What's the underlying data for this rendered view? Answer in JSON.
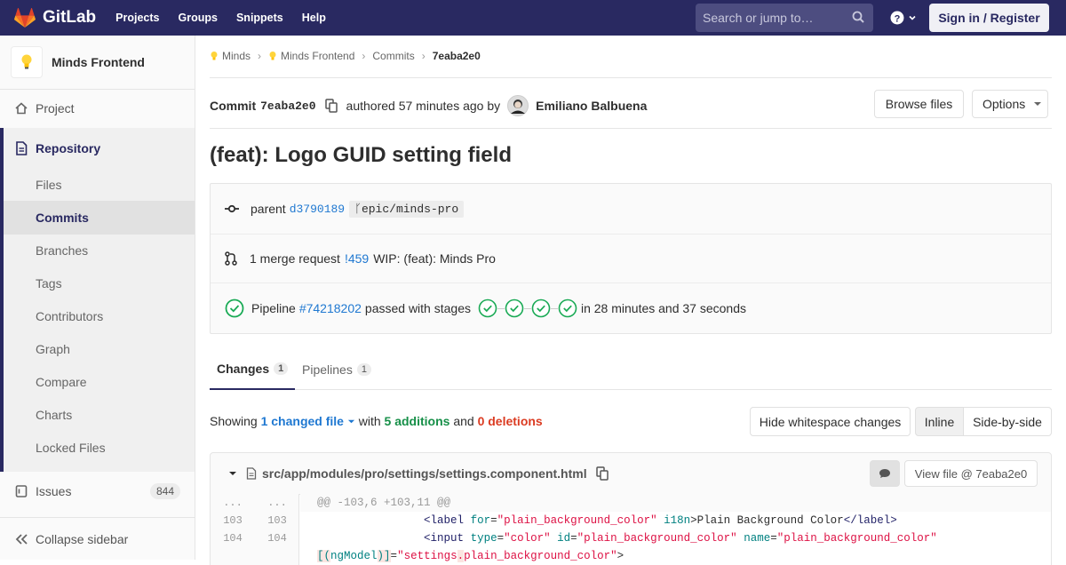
{
  "topbar": {
    "brand": "GitLab",
    "nav": [
      "Projects",
      "Groups",
      "Snippets",
      "Help"
    ],
    "search_placeholder": "Search or jump to…",
    "sign_in": "Sign in / Register"
  },
  "sidebar": {
    "project_name": "Minds Frontend",
    "project": "Project",
    "repository": "Repository",
    "repo_items": [
      "Files",
      "Commits",
      "Branches",
      "Tags",
      "Contributors",
      "Graph",
      "Compare",
      "Charts",
      "Locked Files"
    ],
    "issues": "Issues",
    "issues_count": "844",
    "collapse": "Collapse sidebar"
  },
  "breadcrumbs": [
    "Minds",
    "Minds Frontend",
    "Commits",
    "7eaba2e0"
  ],
  "commit": {
    "label": "Commit",
    "sha": "7eaba2e0",
    "authored": "authored 57 minutes ago by",
    "author": "Emiliano Balbuena",
    "browse_files": "Browse files",
    "options": "Options",
    "title": "(feat): Logo GUID setting field"
  },
  "info": {
    "parent_label": "parent",
    "parent_sha": "d3790189",
    "branch": "epic/minds-pro",
    "mr_text": "1 merge request",
    "mr_link": "!459",
    "mr_title": "WIP: (feat): Minds Pro",
    "pipeline_label": "Pipeline",
    "pipeline_link": "#74218202",
    "pipeline_passed": "passed with stages",
    "pipeline_time": "in 28 minutes and 37 seconds",
    "stage_count": 4
  },
  "tabs": [
    {
      "label": "Changes",
      "count": "1"
    },
    {
      "label": "Pipelines",
      "count": "1"
    }
  ],
  "summary": {
    "showing": "Showing",
    "changed": "1 changed file",
    "with": "with",
    "additions": "5 additions",
    "and": "and",
    "deletions": "0 deletions",
    "hide_ws": "Hide whitespace changes",
    "inline": "Inline",
    "side": "Side-by-side"
  },
  "file": {
    "path": "src/app/modules/pro/settings/settings.component.html",
    "view_file": "View file @ 7eaba2e0"
  },
  "diff": {
    "hunk_old": "...",
    "hunk_new": "...",
    "hunk_header": "@@ -103,6 +103,11 @@",
    "l1_old": "103",
    "l1_new": "103",
    "l2_old": "104",
    "l2_new": "104"
  }
}
